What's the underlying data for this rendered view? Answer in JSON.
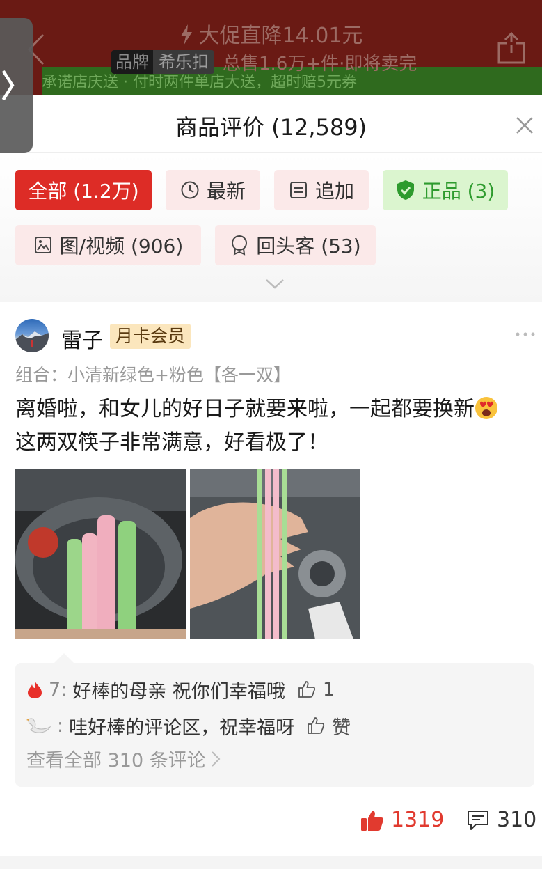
{
  "banner": {
    "promo_text": "大促直降14.01元",
    "brand_label": "品牌",
    "brand_name": "希乐扣",
    "sales_text": "总售1.6万+件·即将卖完",
    "green_strip_text": "承诺店庆送 · 付时两件单店大送，超时赔5元券",
    "handle_glyph": "〉"
  },
  "sheet": {
    "title": "商品评价 (12,589)"
  },
  "filters": [
    {
      "label": "全部 (1.2万)",
      "icon": "none",
      "state": "active"
    },
    {
      "label": "最新",
      "icon": "clock-icon",
      "state": "normal"
    },
    {
      "label": "追加",
      "icon": "list-icon",
      "state": "normal"
    },
    {
      "label": "正品 (3)",
      "icon": "shield-check-icon",
      "state": "green"
    },
    {
      "label": "图/视频 (906)",
      "icon": "image-icon",
      "state": "normal"
    },
    {
      "label": "回头客 (53)",
      "icon": "badge-icon",
      "state": "normal"
    }
  ],
  "review": {
    "username": "雷子",
    "member_badge": "月卡会员",
    "variant": "组合：小清新绿色+粉色【各一双】",
    "text_line1": "离婚啦，和女儿的好日子就要来啦，一起都要换新",
    "text_line2": "这两双筷子非常满意，好看极了！",
    "emoji": "heart-eyes-emoji",
    "comments": [
      {
        "user": "7:",
        "user_icon": "flame-icon",
        "text": "好棒的母亲 祝你们幸福哦",
        "like_label": "1"
      },
      {
        "user": ":",
        "user_icon": "swan-icon",
        "text": "哇好棒的评论区，祝幸福呀",
        "like_label": "赞"
      }
    ],
    "view_all": "查看全部 310 条评论",
    "likes": "1319",
    "comment_count": "310"
  },
  "colors": {
    "accent_red": "#dd2c26",
    "green_chip_text": "#2e9b2e",
    "like_red": "#e13a2f",
    "member_badge_bg": "#fbe6bd"
  }
}
